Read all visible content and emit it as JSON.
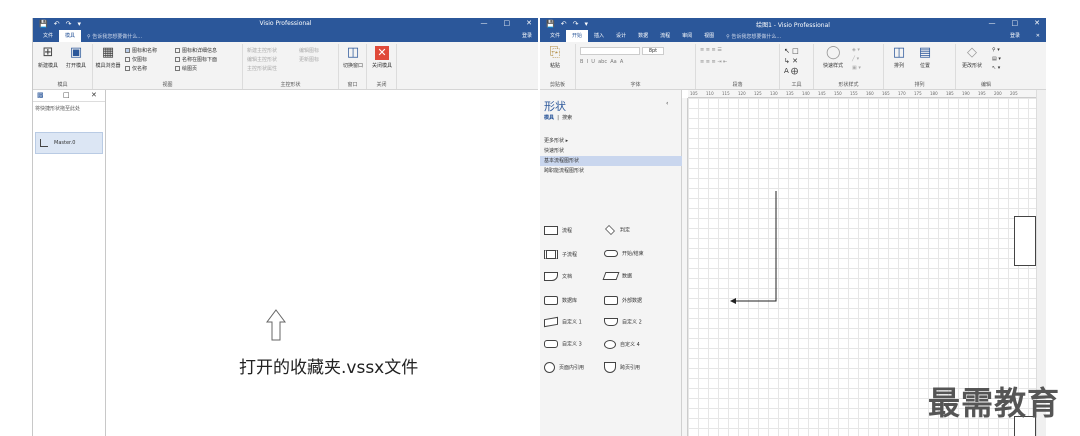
{
  "left_window": {
    "title": "Visio Professional",
    "tabs": [
      "文件",
      "模具"
    ],
    "tell_me": "告诉我您想要做什么...",
    "login": "登录",
    "ribbon": {
      "new_stencil": "新建模具",
      "open_stencil": "打开模具",
      "stencil_browser": "模具浏览器",
      "icons_and_names": "图标和名称",
      "icons_only": "仅图标",
      "names_only": "仅名称",
      "icons_and_details": "图标和详细信息",
      "names_under_icons": "名称在图标下面",
      "use_page": "绘图页",
      "new_master": "新建主控形状",
      "edit_master": "编辑主控形状",
      "master_properties": "主控形状属性",
      "edit_icon": "编辑图标",
      "update_icon": "更新图标",
      "switch_window": "切换窗口",
      "close_stencil": "关闭模具",
      "group_stencil": "模具",
      "group_view": "视图",
      "group_master": "主控形状",
      "group_window": "窗口",
      "group_close": "关闭"
    },
    "panel": {
      "hint": "将快捷形状拖至此处",
      "master_name": "Master.0"
    },
    "caption": "打开的收藏夹.vssx文件"
  },
  "right_window": {
    "title": "绘图1 - Visio Professional",
    "tabs": [
      "文件",
      "开始",
      "插入",
      "设计",
      "数据",
      "流程",
      "审阅",
      "视图"
    ],
    "tell_me": "告诉我您想要做什么...",
    "login": "登录",
    "ribbon": {
      "paste": "粘贴",
      "font_size": "8pt",
      "quick_styles": "快速样式",
      "arrange": "排列",
      "position": "位置",
      "change_shape": "更改形状",
      "group_clipboard": "剪贴板",
      "group_font": "字体",
      "group_paragraph": "段落",
      "group_tools": "工具",
      "group_shape_styles": "形状样式",
      "group_arrange": "排列",
      "group_edit": "编辑"
    },
    "shapes_panel": {
      "title": "形状",
      "tab_stencil": "模具",
      "tab_search": "搜索",
      "more_shapes": "更多形状",
      "quick_shapes": "快速形状",
      "basic_flowchart": "基本流程图形状",
      "cross_functional": "跨职能流程图形状",
      "shapes": [
        "流程",
        "判定",
        "子流程",
        "开始/结束",
        "文档",
        "数据",
        "数据库",
        "外部数据",
        "自定义 1",
        "自定义 2",
        "自定义 3",
        "自定义 4",
        "页面内引用",
        "跨页引用"
      ]
    },
    "ruler": [
      "105",
      "110",
      "115",
      "120",
      "125",
      "130",
      "135",
      "140",
      "145",
      "150",
      "155",
      "160",
      "165",
      "170",
      "175",
      "180",
      "185",
      "190",
      "195",
      "200",
      "205"
    ]
  },
  "watermark": "最需教育",
  "colors": {
    "title_bar": "#2b579a",
    "ribbon": "#f3f3f3",
    "selected": "#c9d6ee"
  }
}
